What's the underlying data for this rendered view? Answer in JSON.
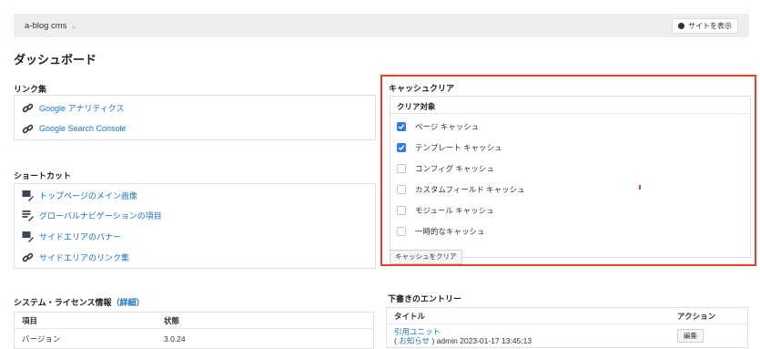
{
  "topbar": {
    "site_name": "a-blog cms",
    "view_site_label": "サイトを表示"
  },
  "page_title": "ダッシュボード",
  "links": {
    "title": "リンク集",
    "items": [
      {
        "label": "Google アナリティクス",
        "icon": "link-icon"
      },
      {
        "label": "Google Search Console",
        "icon": "link-icon"
      }
    ]
  },
  "shortcuts": {
    "title": "ショートカット",
    "items": [
      {
        "label": "トップページのメイン画像",
        "icon": "image-edit-icon"
      },
      {
        "label": "グローバルナビゲーションの項目",
        "icon": "list-edit-icon"
      },
      {
        "label": "サイドエリアのバナー",
        "icon": "image-edit-icon"
      },
      {
        "label": "サイドエリアのリンク集",
        "icon": "link-icon"
      }
    ]
  },
  "cache": {
    "title": "キャッシュクリア",
    "target_header": "クリア対象",
    "options": [
      {
        "label": "ページ キャッシュ",
        "checked": true
      },
      {
        "label": "テンプレート キャッシュ",
        "checked": true
      },
      {
        "label": "コンフィグ キャッシュ",
        "checked": false
      },
      {
        "label": "カスタムフィールド キャッシュ",
        "checked": false
      },
      {
        "label": "モジュール キャッシュ",
        "checked": false
      },
      {
        "label": "一時的なキャッシュ",
        "checked": false
      }
    ],
    "clear_button": "キャッシュをクリア",
    "accent_color": "#e2422e"
  },
  "system": {
    "title": "システム・ライセンス情報",
    "detail_link": "（詳細）",
    "columns": [
      "項目",
      "状態"
    ],
    "rows": [
      [
        "バージョン",
        "3.0.24"
      ]
    ]
  },
  "drafts": {
    "title": "下書きのエントリー",
    "columns": [
      "タイトル",
      "アクション"
    ],
    "rows": [
      {
        "title": "引用ユニット",
        "category_open": "(",
        "category": "お知らせ",
        "category_close": ")",
        "meta": "admin 2023-01-17 13:45:13",
        "action": "編集"
      }
    ]
  },
  "colors": {
    "link": "#1a73c8",
    "checkbox": "#2f7de1",
    "highlight": "#e2422e"
  }
}
